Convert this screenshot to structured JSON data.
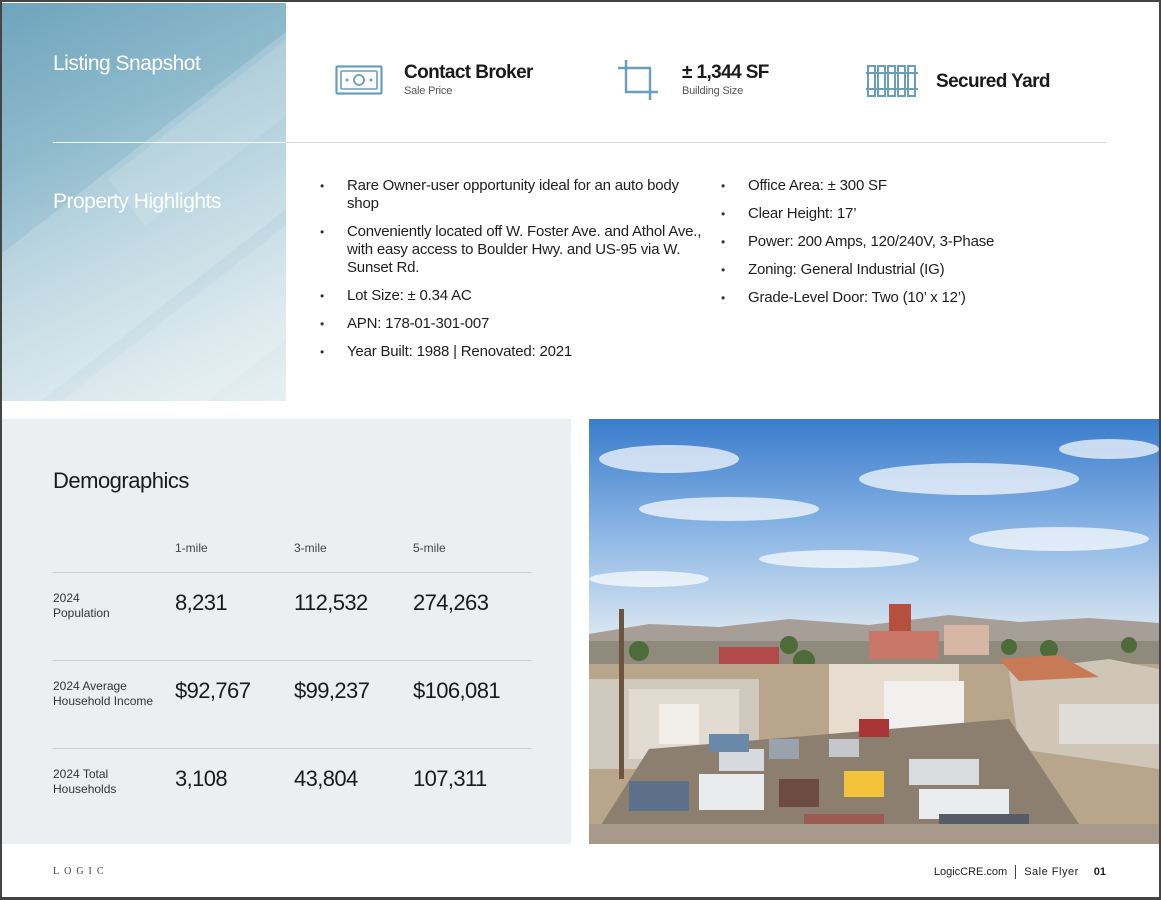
{
  "listing_snapshot": {
    "title": "Listing Snapshot",
    "items": [
      {
        "icon": "money-bill-icon",
        "value": "Contact Broker",
        "label": "Sale Price"
      },
      {
        "icon": "crop-icon",
        "value": "± 1,344 SF",
        "label": "Building Size"
      },
      {
        "icon": "fence-icon",
        "value": "Secured Yard",
        "label": ""
      }
    ]
  },
  "property_highlights": {
    "title": "Property Highlights",
    "left": [
      "Rare Owner-user opportunity ideal for an auto body shop",
      "Conveniently located off W. Foster Ave. and Athol Ave., with easy access to Boulder Hwy. and US-95 via W. Sunset Rd.",
      "Lot Size: ± 0.34 AC",
      "APN: 178-01-301-007",
      "Year Built: 1988 | Renovated: 2021"
    ],
    "right": [
      "Office Area: ± 300 SF",
      "Clear Height: 17’",
      "Power: 200 Amps, 120/240V, 3-Phase",
      "Zoning: General Industrial (IG)",
      "Grade-Level Door: Two (10’ x 12’)"
    ]
  },
  "demographics": {
    "title": "Demographics",
    "columns": [
      "1-mile",
      "3-mile",
      "5-mile"
    ],
    "rows": [
      {
        "label_1": "2024",
        "label_2": "Population",
        "values": [
          "8,231",
          "112,532",
          "274,263"
        ]
      },
      {
        "label_1": "2024 Average",
        "label_2": "Household Income",
        "values": [
          "$92,767",
          "$99,237",
          "$106,081"
        ]
      },
      {
        "label_1": "2024 Total",
        "label_2": "Households",
        "values": [
          "3,108",
          "43,804",
          "107,311"
        ]
      }
    ]
  },
  "photo": {
    "icon": "property-photo"
  },
  "footer": {
    "logo": "LOGIC",
    "website": "LogicCRE.com",
    "doc_type": "Sale Flyer",
    "page": "01"
  },
  "colors": {
    "panel_blue_dark": "#6fa4bd",
    "panel_blue_light": "#e6eff3",
    "icon_blue": "#6a9fba",
    "demo_bg": "#eceeef"
  }
}
